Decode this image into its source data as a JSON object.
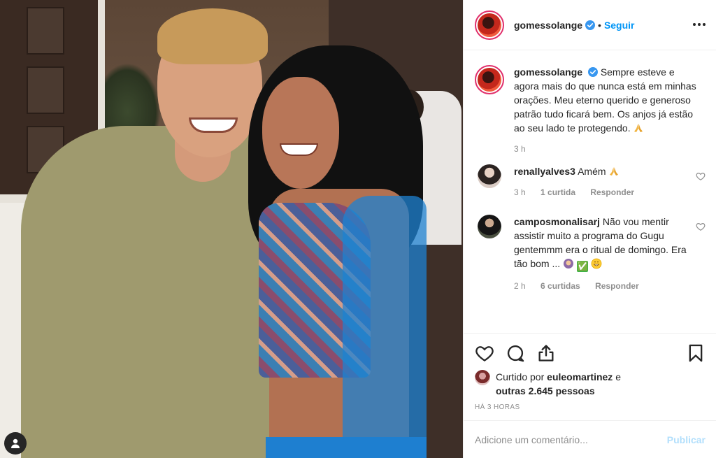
{
  "colors": {
    "link": "#0095f6",
    "muted": "#8e8e8e",
    "publish_disabled": "#b2dffc",
    "verified": "#3897f0"
  },
  "header": {
    "username": "gomessolange",
    "separator": "•",
    "follow_label": "Seguir",
    "more_icon": "more-horizontal-icon"
  },
  "caption": {
    "username": "gomessolange",
    "text": "Sempre esteve e agora mais do que nunca está em minhas orações. Meu eterno querido e generoso patrão tudo ficará bem. Os anjos já estão ao seu lado te protegendo.",
    "emoji": "praying-hands-emoji",
    "time": "3 h"
  },
  "comments": [
    {
      "username": "renallyalves3",
      "text": "Amém",
      "emoji": "praying-hands-emoji",
      "time": "3 h",
      "likes": "1 curtida",
      "reply_label": "Responder"
    },
    {
      "username": "camposmonalisarj",
      "text": "Não vou mentir assistir muito a programa do Gugu gentemmm era o ritual de domingo. Era tão bom ...",
      "emoji_check": "✅",
      "emoji_extra": "grinning-emoji",
      "time": "2 h",
      "likes": "6 curtidas",
      "reply_label": "Responder"
    }
  ],
  "likes": {
    "prefix": "Curtido por",
    "user": "euleomartinez",
    "conj": "e",
    "others": "outras 2.645 pessoas"
  },
  "timestamp": "HÁ 3 HORAS",
  "add_comment": {
    "placeholder": "Adicione um comentário...",
    "publish_label": "Publicar"
  }
}
